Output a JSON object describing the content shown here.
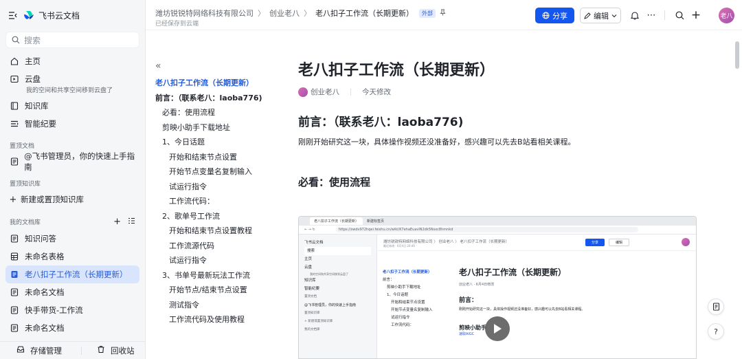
{
  "sidebar": {
    "app_title": "飞书云文档",
    "search_placeholder": "搜索",
    "nav": [
      {
        "label": "主页",
        "icon": "home-icon"
      },
      {
        "label": "云盘",
        "icon": "cloud-drive-icon",
        "sub": "我的空间和共享空间移到云盘了"
      },
      {
        "label": "知识库",
        "icon": "wiki-icon"
      },
      {
        "label": "智能纪要",
        "icon": "smart-notes-icon"
      }
    ],
    "pinned_docs_title": "置顶文档",
    "pinned_docs": [
      {
        "label": "@飞书管理员，你的快速上手指南"
      }
    ],
    "pinned_wiki_title": "置顶知识库",
    "pinned_wiki_add": "新建或置顶知识库",
    "my_docs_title": "我的文档库",
    "my_docs": [
      {
        "label": "知识问答"
      },
      {
        "label": "未命名表格"
      },
      {
        "label": "老八扣子工作流（长期更新）"
      },
      {
        "label": "未命名文档"
      },
      {
        "label": "快手带货-工作流"
      },
      {
        "label": "未命名文档"
      }
    ],
    "footer_storage": "存储管理",
    "footer_trash": "回收站"
  },
  "topbar": {
    "breadcrumb_org": "潍坊锐锐特网络科技有限公司",
    "breadcrumb_space": "创业老八",
    "breadcrumb_current": "老八扣子工作流（长期更新）",
    "external_badge": "外部",
    "saved_status": "已经保存到云端",
    "share_label": "分享",
    "edit_label": "编辑",
    "avatar_text": "老八"
  },
  "outline": {
    "items": [
      {
        "label": "老八扣子工作流（长期更新）",
        "level": 1,
        "active": true
      },
      {
        "label": "前言：（联系老八：laoba776)",
        "level": 1,
        "bold": true
      },
      {
        "label": "必看：使用流程",
        "level": 2
      },
      {
        "label": "剪映小助手下载地址",
        "level": 2
      },
      {
        "label": "1、今日话题",
        "level": 2
      },
      {
        "label": "开始和结束节点设置",
        "level": 3
      },
      {
        "label": "开始节点变量名复制输入",
        "level": 3
      },
      {
        "label": "试运行指令",
        "level": 3
      },
      {
        "label": "工作流代码：",
        "level": 3
      },
      {
        "label": "2、歌单号工作流",
        "level": 2
      },
      {
        "label": "开始和结束节点设置教程",
        "level": 3
      },
      {
        "label": "工作流源代码",
        "level": 3
      },
      {
        "label": "试运行指令",
        "level": 3
      },
      {
        "label": "3、书单号最新玩法工作流",
        "level": 2
      },
      {
        "label": "开始节点/结束节点设置",
        "level": 3
      },
      {
        "label": "测试指令",
        "level": 3
      },
      {
        "label": "工作流代码及使用教程",
        "level": 3
      }
    ]
  },
  "doc": {
    "title": "老八扣子工作流（长期更新）",
    "author": "创业老八",
    "modified": "今天修改",
    "h_preface": "前言：（联系老八：laoba776)",
    "preface_text": "刚刚开始研究这一块，具体操作视频还没准备好，感兴趣可以先去B站看相关课程。",
    "h_usage": "必看：使用流程"
  },
  "embedded": {
    "tab1": "老八扣子工作流（长期更新）",
    "tab2": "新建标签页",
    "url": "https://swdv972hqei.feishu.cn/wiki/K7ehaEuavlN2dk5Nsxc8hmnkd",
    "sb_title": "飞书云文档",
    "sb_search": "搜索",
    "sb_home": "主页",
    "sb_cloud": "云盘",
    "sb_cloud_sub": "我的空间和共享空间移到云盘了",
    "sb_wiki": "知识库",
    "sb_notes": "智能纪要",
    "sb_pinned": "置顶文档",
    "sb_pinned_doc": "@飞书管理员，你的快速上手指南",
    "sb_pinned_wiki": "置顶知识库",
    "sb_add_wiki": "+ 新建或置顶知识库",
    "sb_my": "我的文档库",
    "crumbs": "潍坊锐锐特网络科技有限公司 〉 创业老八 〉 老八扣子工作流（长期更新）",
    "saved": "最近修改：6月4日 20:46",
    "share": "分享",
    "edit": "编辑",
    "ol": [
      "老八扣子工作流（长期更新）",
      "前言：",
      "剪映小助手下载地址",
      "1、今日话题",
      "开始和结束节点设置",
      "开始节点变量名复制输入",
      "试运行指令",
      "工作流代码："
    ],
    "doc_title": "老八扣子工作流（长期更新）",
    "doc_meta": "创业老八 · 6月4日修改",
    "doc_h": "前言：",
    "doc_p": "刚刚开始研究这一块，具体操作视频还没准备好，感兴趣可以先去B站看相关课程。",
    "doc_h3": "剪映小助手",
    "doc_link": "速取AIGC"
  }
}
